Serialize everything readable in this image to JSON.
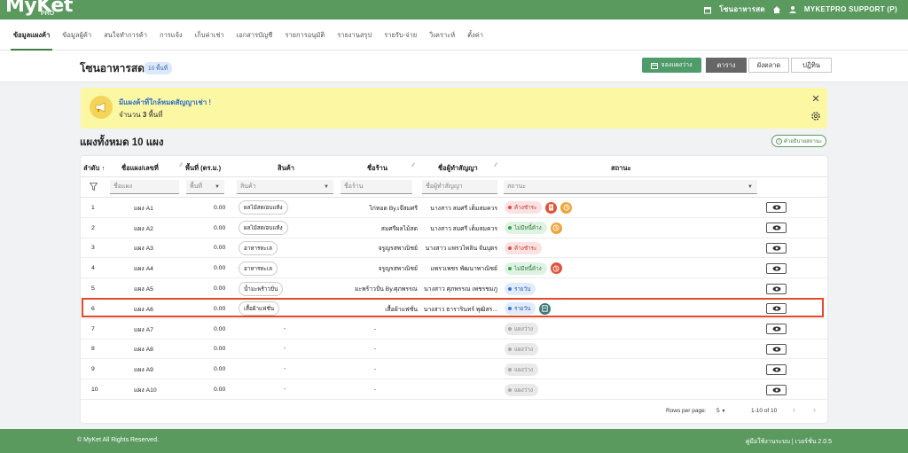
{
  "app": {
    "logo": "MyKet",
    "logo_sub": "PRO"
  },
  "topbar": {
    "shop": "โซนอาหารสด",
    "user": "MYKETPRO SUPPORT (P)"
  },
  "nav": [
    "ข้อมูลแผงค้า",
    "ข้อมูลผู้ค้า",
    "สนใจทำการค้า",
    "การแจ้ง",
    "เก็บค่าเช่า",
    "เอกสารบัญชี",
    "รายการอนุมัติ",
    "รายงานสรุป",
    "รายรับ-จ่าย",
    "วิเคราะห์",
    "ตั้งค่า"
  ],
  "page": {
    "title": "โซนอาหารสด",
    "count_badge": "10 พื้นที่",
    "reserve_btn": "จองแผงว่าง",
    "views": [
      "ตาราง",
      "ผังตลาด",
      "ปฏิทิน"
    ]
  },
  "alert": {
    "title": "มีแผงค้าที่ใกล้หมดสัญญาเช่า !",
    "sub_prefix": "จำนวน",
    "sub_count": "3",
    "sub_suffix": "พื้นที่"
  },
  "section": {
    "title": "แผงทั้งหมด 10 แผง",
    "help": "คำอธิบายสถานะ"
  },
  "table": {
    "headers": {
      "no": "ลำดับ",
      "name": "ชื่อแผง/เลขที่",
      "area": "พื้นที่ (ตร.ม.)",
      "product": "สินค้า",
      "shop": "ชื่อร้าน",
      "owner": "ชื่อผู้ทำสัญญา",
      "status": "สถานะ"
    },
    "filters": {
      "name": "ชื่อแผง",
      "area": "พื้นที่",
      "product": "สินค้า",
      "shop": "ชื่อร้าน",
      "owner": "ชื่อผู้ทำสัญญา",
      "status": "สถานะ"
    },
    "rows": [
      {
        "no": "1",
        "name": "แผง A1",
        "area": "0.00",
        "product": "ผลไม้สด/อบแห้ง",
        "shop": "ไก่ทอด By.เจ๊สมศรี",
        "owner": "นางสาว สมศรี เต็มสมควร",
        "status": "ค้างชำระ"
      },
      {
        "no": "2",
        "name": "แผง A2",
        "area": "0.00",
        "product": "ผลไม้สด/อบแห้ง",
        "shop": "สมศรีผลไม้สด",
        "owner": "นางสาว สมศรี เต็มสมควร",
        "status": "ไม่มีหนี้ค้าง"
      },
      {
        "no": "3",
        "name": "แผง A3",
        "area": "0.00",
        "product": "อาหารทะเล",
        "shop": "จรูญรสพาณิชย์",
        "owner": "นางสาว แพรวไพลิน จันบุตร",
        "status": "ค้างชำระ"
      },
      {
        "no": "4",
        "name": "แผง A4",
        "area": "0.00",
        "product": "อาหารทะเล",
        "shop": "จรูญรสพาณิชย์",
        "owner": "แพรวเพชร พัฒนาพาณิชย์",
        "status": "ไม่มีหนี้ค้าง"
      },
      {
        "no": "5",
        "name": "แผง A5",
        "area": "0.00",
        "product": "น้ำมะพร้าวปั่น",
        "shop": "มะพร้าวปั่น By.ศุภพรรณ",
        "owner": "นางสาว ศุภพรรณ เพชรชมภู",
        "status": "รายวัน"
      },
      {
        "no": "6",
        "name": "แผง A6",
        "area": "0.00",
        "product": "เสื้อผ้าแฟชั่น",
        "shop": "เสื้อผ้าแฟชั่น",
        "owner": "นางสาว ธารารินทร์ พุฒิสร...",
        "status": "รายวัน"
      },
      {
        "no": "7",
        "name": "แผง A7",
        "area": "0.00",
        "product": "-",
        "shop": "-",
        "owner": "",
        "status": "แผงว่าง"
      },
      {
        "no": "8",
        "name": "แผง A8",
        "area": "0.00",
        "product": "-",
        "shop": "-",
        "owner": "",
        "status": "แผงว่าง"
      },
      {
        "no": "9",
        "name": "แผง A9",
        "area": "0.00",
        "product": "-",
        "shop": "-",
        "owner": "",
        "status": "แผงว่าง"
      },
      {
        "no": "10",
        "name": "แผง A10",
        "area": "0.00",
        "product": "-",
        "shop": "-",
        "owner": "",
        "status": "แผงว่าง"
      }
    ]
  },
  "pager": {
    "rows_label": "Rows per page:",
    "rows_value": "5",
    "range": "1-10 of 10"
  },
  "footer": {
    "left": "© MyKet All Rights Reserved.",
    "right": "คู่มือใช้งานระบบ | เวอร์ชั่น 2.0.5"
  },
  "colors": {
    "brand": "#5a9a5f",
    "highlight": "#e24a2a"
  }
}
